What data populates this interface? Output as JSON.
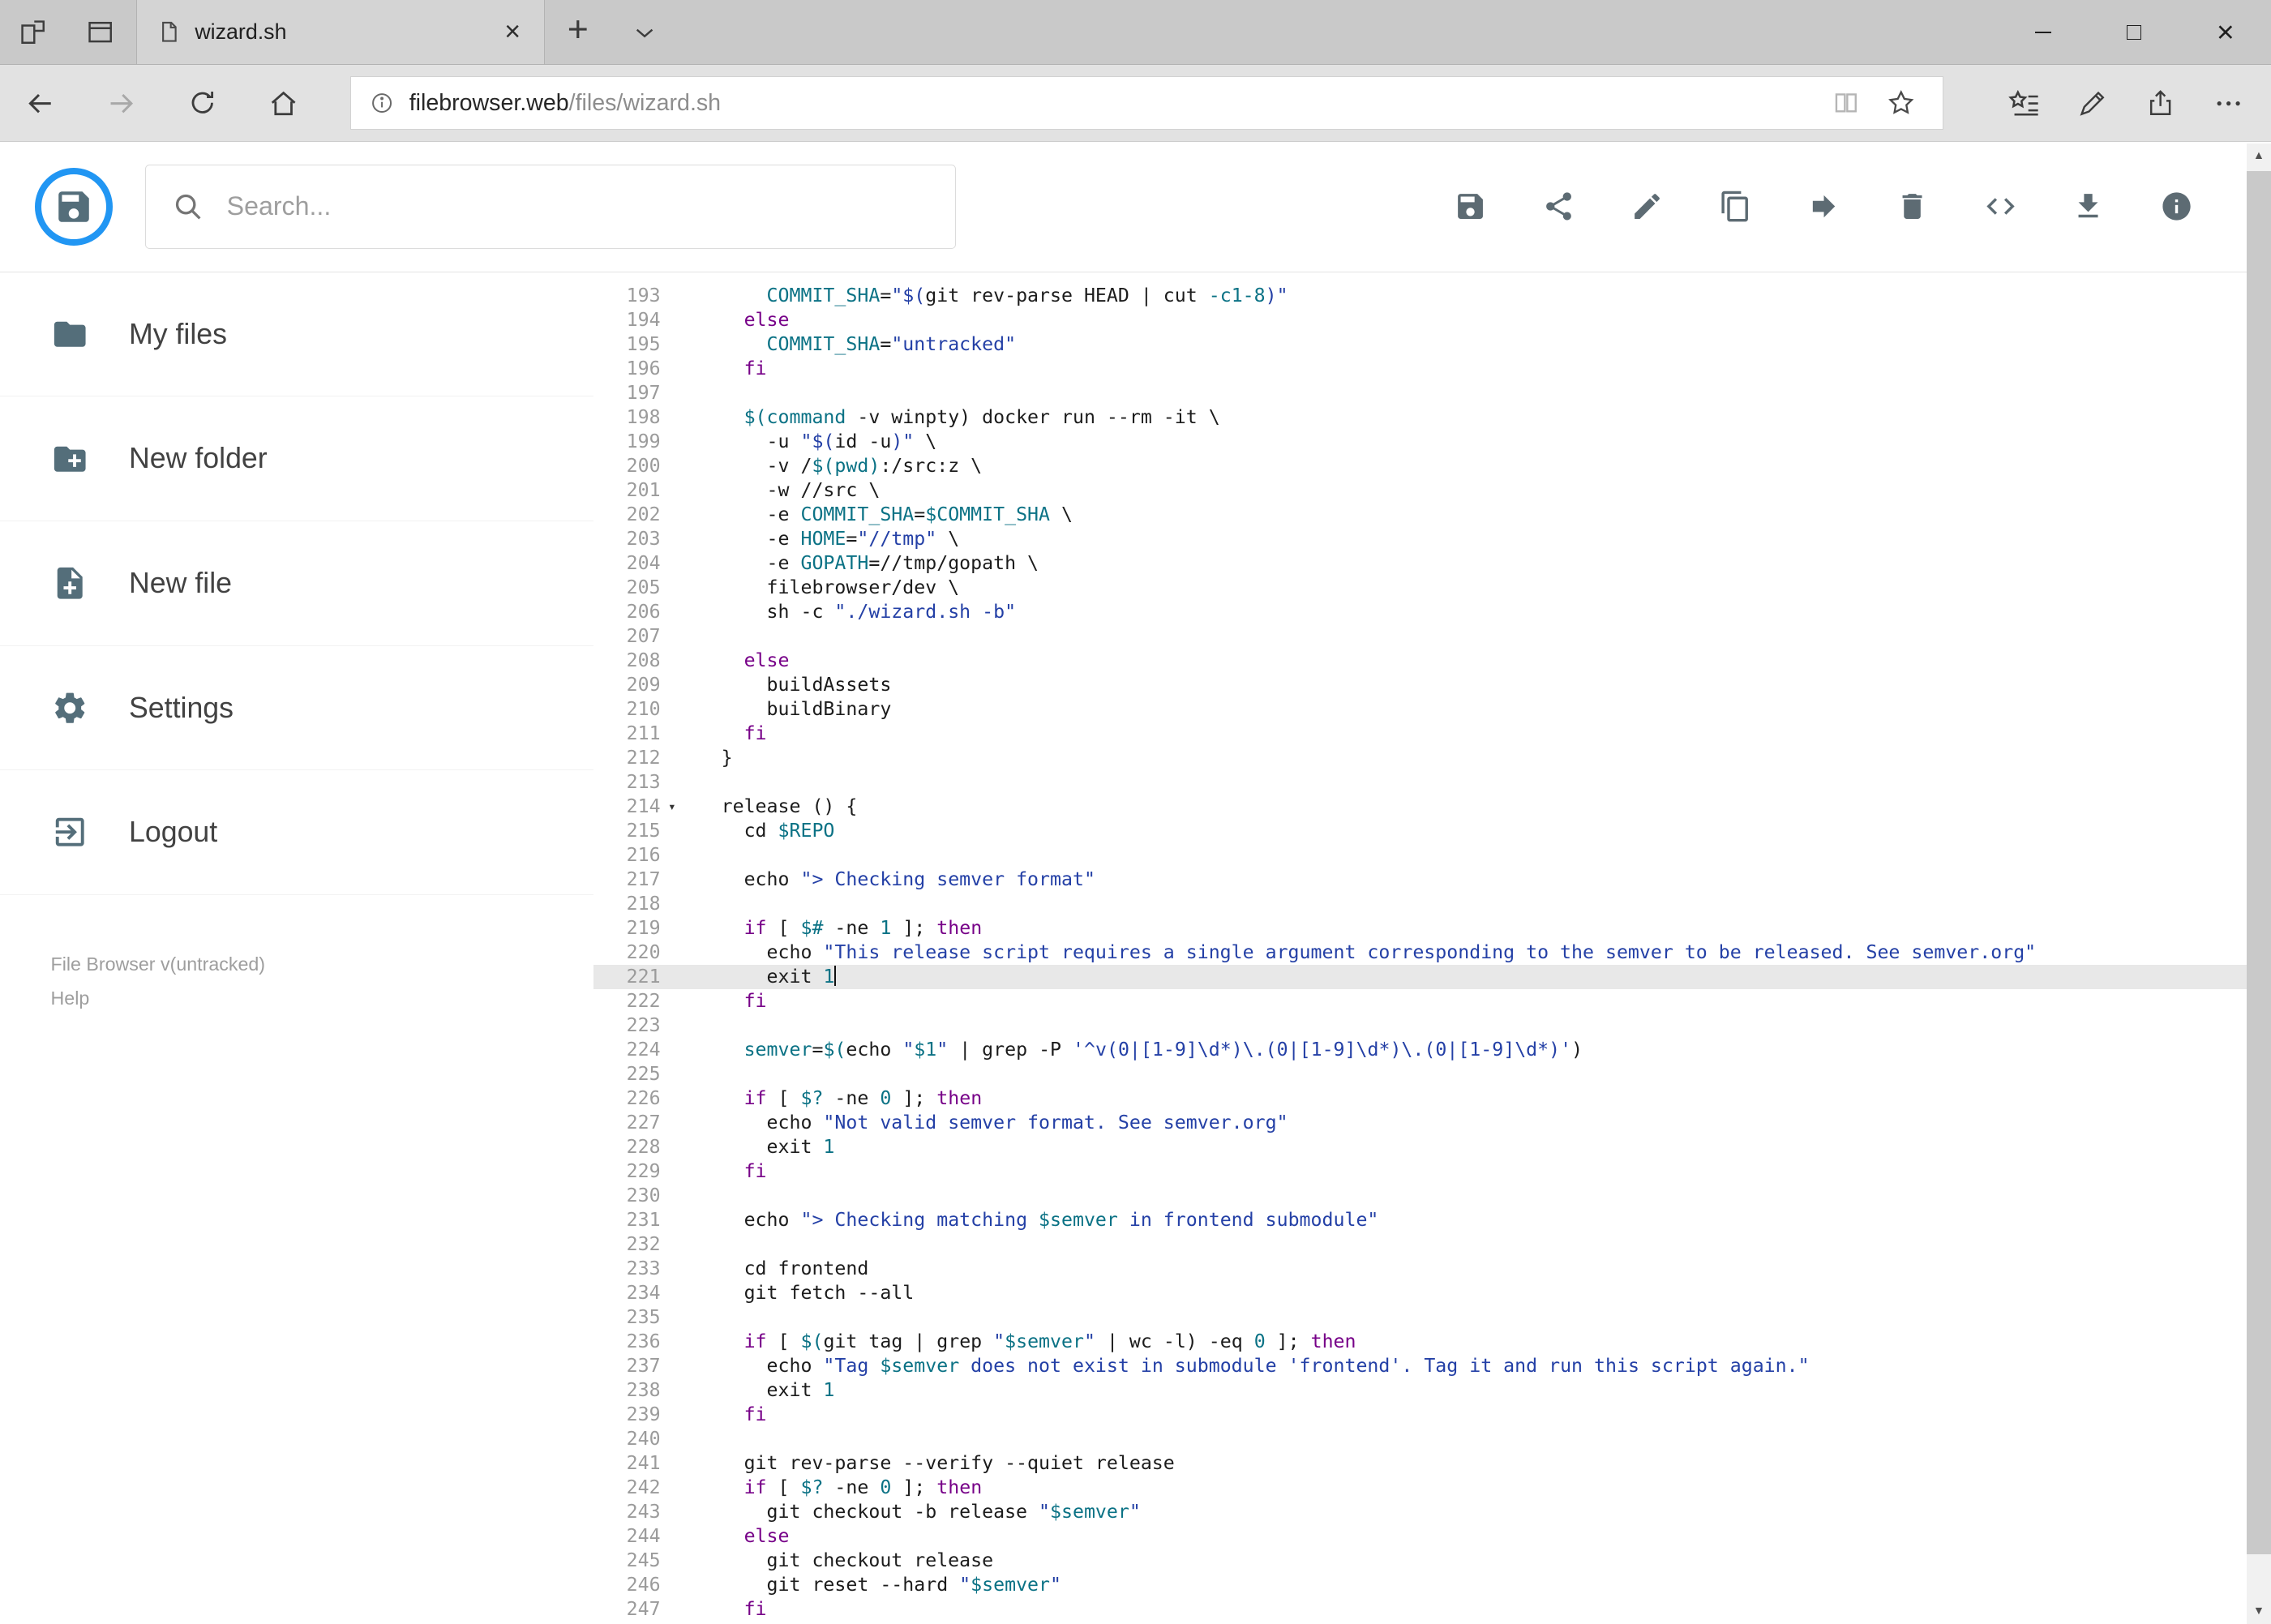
{
  "browser": {
    "tab_title": "wizard.sh",
    "url_host": "filebrowser.web",
    "url_path": "/files/wizard.sh"
  },
  "app": {
    "search_placeholder": "Search...",
    "toolbar_actions": [
      {
        "name": "save"
      },
      {
        "name": "share"
      },
      {
        "name": "edit"
      },
      {
        "name": "copy"
      },
      {
        "name": "move"
      },
      {
        "name": "delete"
      },
      {
        "name": "code"
      },
      {
        "name": "download"
      },
      {
        "name": "info"
      }
    ],
    "sidebar": {
      "items": [
        {
          "icon": "folder",
          "label": "My files"
        },
        {
          "icon": "new-folder",
          "label": "New folder"
        },
        {
          "icon": "new-file",
          "label": "New file"
        },
        {
          "icon": "settings",
          "label": "Settings"
        },
        {
          "icon": "logout",
          "label": "Logout"
        }
      ],
      "version": "File Browser v(untracked)",
      "help": "Help"
    }
  },
  "editor": {
    "active_line": 221,
    "cursor_line": 221,
    "fold_line": 214,
    "lines": [
      {
        "n": 193,
        "t": [
          [
            "p",
            "    "
          ],
          [
            "v",
            "COMMIT_SHA"
          ],
          [
            "p",
            "="
          ],
          [
            "s",
            "\"$("
          ],
          [
            "p",
            "git rev-parse HEAD | cut "
          ],
          [
            "v",
            "-c1-8"
          ],
          [
            "s",
            ")\""
          ]
        ]
      },
      {
        "n": 194,
        "t": [
          [
            "p",
            "  "
          ],
          [
            "k",
            "else"
          ]
        ]
      },
      {
        "n": 195,
        "t": [
          [
            "p",
            "    "
          ],
          [
            "v",
            "COMMIT_SHA"
          ],
          [
            "p",
            "="
          ],
          [
            "s",
            "\"untracked\""
          ]
        ]
      },
      {
        "n": 196,
        "t": [
          [
            "p",
            "  "
          ],
          [
            "k",
            "fi"
          ]
        ]
      },
      {
        "n": 197,
        "t": []
      },
      {
        "n": 198,
        "t": [
          [
            "p",
            "  "
          ],
          [
            "v",
            "$(command"
          ],
          [
            "p",
            " -v winpty) docker run --rm -it \\"
          ]
        ]
      },
      {
        "n": 199,
        "t": [
          [
            "p",
            "    -u "
          ],
          [
            "s",
            "\"$("
          ],
          [
            "p",
            "id -u"
          ],
          [
            "s",
            ")\""
          ],
          [
            "p",
            " \\"
          ]
        ]
      },
      {
        "n": 200,
        "t": [
          [
            "p",
            "    -v /"
          ],
          [
            "v",
            "$(pwd)"
          ],
          [
            "p",
            ":/src:z \\"
          ]
        ]
      },
      {
        "n": 201,
        "t": [
          [
            "p",
            "    -w //src \\"
          ]
        ]
      },
      {
        "n": 202,
        "t": [
          [
            "p",
            "    -e "
          ],
          [
            "v",
            "COMMIT_SHA"
          ],
          [
            "p",
            "="
          ],
          [
            "v",
            "$COMMIT_SHA"
          ],
          [
            "p",
            " \\"
          ]
        ]
      },
      {
        "n": 203,
        "t": [
          [
            "p",
            "    -e "
          ],
          [
            "v",
            "HOME"
          ],
          [
            "p",
            "="
          ],
          [
            "s",
            "\"//tmp\""
          ],
          [
            "p",
            " \\"
          ]
        ]
      },
      {
        "n": 204,
        "t": [
          [
            "p",
            "    -e "
          ],
          [
            "v",
            "GOPATH"
          ],
          [
            "p",
            "=//tmp/gopath \\"
          ]
        ]
      },
      {
        "n": 205,
        "t": [
          [
            "p",
            "    filebrowser/dev \\"
          ]
        ]
      },
      {
        "n": 206,
        "t": [
          [
            "p",
            "    sh -c "
          ],
          [
            "s",
            "\"./wizard.sh -b\""
          ]
        ]
      },
      {
        "n": 207,
        "t": []
      },
      {
        "n": 208,
        "t": [
          [
            "p",
            "  "
          ],
          [
            "k",
            "else"
          ]
        ]
      },
      {
        "n": 209,
        "t": [
          [
            "p",
            "    buildAssets"
          ]
        ]
      },
      {
        "n": 210,
        "t": [
          [
            "p",
            "    buildBinary"
          ]
        ]
      },
      {
        "n": 211,
        "t": [
          [
            "p",
            "  "
          ],
          [
            "k",
            "fi"
          ]
        ]
      },
      {
        "n": 212,
        "t": [
          [
            "p",
            "}"
          ]
        ]
      },
      {
        "n": 213,
        "t": []
      },
      {
        "n": 214,
        "t": [
          [
            "p",
            "release () {"
          ]
        ]
      },
      {
        "n": 215,
        "t": [
          [
            "p",
            "  cd "
          ],
          [
            "v",
            "$REPO"
          ]
        ]
      },
      {
        "n": 216,
        "t": []
      },
      {
        "n": 217,
        "t": [
          [
            "p",
            "  echo "
          ],
          [
            "s",
            "\"> Checking semver format\""
          ]
        ]
      },
      {
        "n": 218,
        "t": []
      },
      {
        "n": 219,
        "t": [
          [
            "p",
            "  "
          ],
          [
            "k",
            "if"
          ],
          [
            "p",
            " [ "
          ],
          [
            "v",
            "$#"
          ],
          [
            "p",
            " -ne "
          ],
          [
            "v",
            "1"
          ],
          [
            "p",
            " ]; "
          ],
          [
            "k",
            "then"
          ]
        ]
      },
      {
        "n": 220,
        "t": [
          [
            "p",
            "    echo "
          ],
          [
            "s",
            "\"This release script requires a single argument corresponding to the semver to be released. See semver.org\""
          ]
        ]
      },
      {
        "n": 221,
        "t": [
          [
            "p",
            "    exit "
          ],
          [
            "v",
            "1"
          ]
        ]
      },
      {
        "n": 222,
        "t": [
          [
            "p",
            "  "
          ],
          [
            "k",
            "fi"
          ]
        ]
      },
      {
        "n": 223,
        "t": []
      },
      {
        "n": 224,
        "t": [
          [
            "p",
            "  "
          ],
          [
            "v",
            "semver"
          ],
          [
            "p",
            "="
          ],
          [
            "v",
            "$("
          ],
          [
            "p",
            "echo "
          ],
          [
            "s",
            "\""
          ],
          [
            "v",
            "$1"
          ],
          [
            "s",
            "\""
          ],
          [
            "p",
            " | grep -P "
          ],
          [
            "s",
            "'^v(0|[1-9]\\d*)\\.(0|[1-9]\\d*)\\.(0|[1-9]\\d*)'"
          ],
          [
            "p",
            ")"
          ]
        ]
      },
      {
        "n": 225,
        "t": []
      },
      {
        "n": 226,
        "t": [
          [
            "p",
            "  "
          ],
          [
            "k",
            "if"
          ],
          [
            "p",
            " [ "
          ],
          [
            "v",
            "$?"
          ],
          [
            "p",
            " -ne "
          ],
          [
            "v",
            "0"
          ],
          [
            "p",
            " ]; "
          ],
          [
            "k",
            "then"
          ]
        ]
      },
      {
        "n": 227,
        "t": [
          [
            "p",
            "    echo "
          ],
          [
            "s",
            "\"Not valid semver format. See semver.org\""
          ]
        ]
      },
      {
        "n": 228,
        "t": [
          [
            "p",
            "    exit "
          ],
          [
            "v",
            "1"
          ]
        ]
      },
      {
        "n": 229,
        "t": [
          [
            "p",
            "  "
          ],
          [
            "k",
            "fi"
          ]
        ]
      },
      {
        "n": 230,
        "t": []
      },
      {
        "n": 231,
        "t": [
          [
            "p",
            "  echo "
          ],
          [
            "s",
            "\"> Checking matching "
          ],
          [
            "v",
            "$semver"
          ],
          [
            "s",
            " in frontend submodule\""
          ]
        ]
      },
      {
        "n": 232,
        "t": []
      },
      {
        "n": 233,
        "t": [
          [
            "p",
            "  cd frontend"
          ]
        ]
      },
      {
        "n": 234,
        "t": [
          [
            "p",
            "  git fetch --all"
          ]
        ]
      },
      {
        "n": 235,
        "t": []
      },
      {
        "n": 236,
        "t": [
          [
            "p",
            "  "
          ],
          [
            "k",
            "if"
          ],
          [
            "p",
            " [ "
          ],
          [
            "v",
            "$("
          ],
          [
            "p",
            "git tag | grep "
          ],
          [
            "s",
            "\""
          ],
          [
            "v",
            "$semver"
          ],
          [
            "s",
            "\""
          ],
          [
            "p",
            " | wc -l) -eq "
          ],
          [
            "v",
            "0"
          ],
          [
            "p",
            " ]; "
          ],
          [
            "k",
            "then"
          ]
        ]
      },
      {
        "n": 237,
        "t": [
          [
            "p",
            "    echo "
          ],
          [
            "s",
            "\"Tag "
          ],
          [
            "v",
            "$semver"
          ],
          [
            "s",
            " does not exist in submodule 'frontend'. Tag it and run this script again.\""
          ]
        ]
      },
      {
        "n": 238,
        "t": [
          [
            "p",
            "    exit "
          ],
          [
            "v",
            "1"
          ]
        ]
      },
      {
        "n": 239,
        "t": [
          [
            "p",
            "  "
          ],
          [
            "k",
            "fi"
          ]
        ]
      },
      {
        "n": 240,
        "t": []
      },
      {
        "n": 241,
        "t": [
          [
            "p",
            "  git rev-parse --verify --quiet release"
          ]
        ]
      },
      {
        "n": 242,
        "t": [
          [
            "p",
            "  "
          ],
          [
            "k",
            "if"
          ],
          [
            "p",
            " [ "
          ],
          [
            "v",
            "$?"
          ],
          [
            "p",
            " -ne "
          ],
          [
            "v",
            "0"
          ],
          [
            "p",
            " ]; "
          ],
          [
            "k",
            "then"
          ]
        ]
      },
      {
        "n": 243,
        "t": [
          [
            "p",
            "    git checkout -b release "
          ],
          [
            "s",
            "\""
          ],
          [
            "v",
            "$semver"
          ],
          [
            "s",
            "\""
          ]
        ]
      },
      {
        "n": 244,
        "t": [
          [
            "p",
            "  "
          ],
          [
            "k",
            "else"
          ]
        ]
      },
      {
        "n": 245,
        "t": [
          [
            "p",
            "    git checkout release"
          ]
        ]
      },
      {
        "n": 246,
        "t": [
          [
            "p",
            "    git reset --hard "
          ],
          [
            "s",
            "\""
          ],
          [
            "v",
            "$semver"
          ],
          [
            "s",
            "\""
          ]
        ]
      },
      {
        "n": 247,
        "t": [
          [
            "p",
            "  "
          ],
          [
            "k",
            "fi"
          ]
        ]
      }
    ]
  }
}
